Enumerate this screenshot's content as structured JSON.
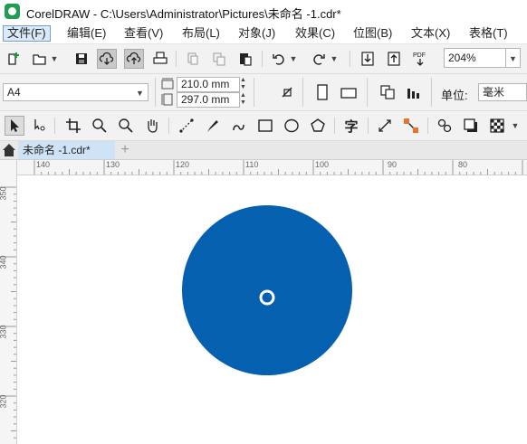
{
  "window": {
    "title": "CorelDRAW - C:\\Users\\Administrator\\Pictures\\未命名 -1.cdr*"
  },
  "menu": [
    {
      "label": "文件(F)",
      "active": true
    },
    {
      "label": "编辑(E)"
    },
    {
      "label": "查看(V)"
    },
    {
      "label": "布局(L)"
    },
    {
      "label": "对象(J)"
    },
    {
      "label": "效果(C)"
    },
    {
      "label": "位图(B)"
    },
    {
      "label": "文本(X)"
    },
    {
      "label": "表格(T)"
    }
  ],
  "standard_toolbar": {
    "zoom_value": "204%",
    "icons": [
      "new-document-icon",
      "open-icon",
      "save-icon",
      "cloud-download-icon",
      "cloud-upload-icon",
      "print-icon",
      "cut-icon",
      "copy-icon",
      "paste-icon",
      "undo-icon",
      "redo-icon",
      "import-icon",
      "export-icon",
      "pdf-icon"
    ]
  },
  "property_bar": {
    "page_size": "A4",
    "width": "210.0 mm",
    "height": "297.0 mm",
    "units_label": "单位:",
    "units_value": "毫米"
  },
  "toolbox_icons": [
    "pick-tool-icon",
    "shape-tool-icon",
    "crop-tool-icon",
    "zoom-tool-icon",
    "zoom-out-icon",
    "pan-tool-icon",
    "freehand-tool-icon",
    "artistic-media-icon",
    "bspline-icon",
    "rectangle-tool-icon",
    "ellipse-tool-icon",
    "polygon-tool-icon",
    "text-tool-icon",
    "parallel-dimension-icon",
    "connector-icon",
    "blend-icon",
    "drop-shadow-icon",
    "transparency-icon"
  ],
  "text_tool_glyph": "字",
  "document_tab": {
    "label": "未命名 -1.cdr*",
    "add_symbol": "+"
  },
  "ruler": {
    "horizontal_labels": [
      "140",
      "130",
      "120",
      "110",
      "100",
      "90",
      "80"
    ],
    "vertical_labels": [
      "350",
      "340",
      "330",
      "320"
    ]
  },
  "colors": {
    "circle_fill": "#0560b0",
    "center_marker": "#ffffff"
  }
}
